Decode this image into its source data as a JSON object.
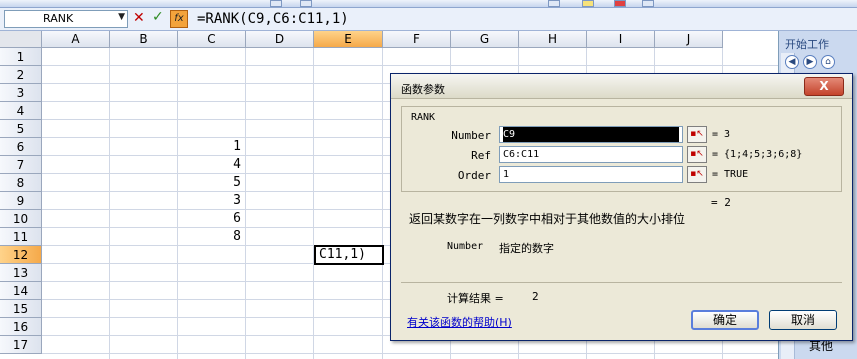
{
  "namebox": {
    "value": "RANK"
  },
  "formula_bar": {
    "formula": "=RANK(C9,C6:C11,1)",
    "fx_label": "fx"
  },
  "columns": [
    "A",
    "B",
    "C",
    "D",
    "E",
    "F",
    "G",
    "H",
    "I",
    "J"
  ],
  "active_column": "E",
  "rows": [
    "1",
    "2",
    "3",
    "4",
    "5",
    "6",
    "7",
    "8",
    "9",
    "10",
    "11",
    "12",
    "13",
    "14",
    "15",
    "16",
    "17"
  ],
  "active_row": "12",
  "cells_column_c": [
    "1",
    "4",
    "5",
    "3",
    "6",
    "8"
  ],
  "active_cell_text": "C11,1)",
  "task_pane": {
    "title": "开始工作",
    "footer": "其他"
  },
  "dialog": {
    "title": "函数参数",
    "close_label": "X",
    "function_name": "RANK",
    "args": [
      {
        "label": "Number",
        "value": "C9",
        "result": "= 3"
      },
      {
        "label": "Ref",
        "value": "C6:C11",
        "result": "= {1;4;5;3;6;8}"
      },
      {
        "label": "Order",
        "value": "1",
        "result": "= TRUE"
      }
    ],
    "formula_result": "= 2",
    "description": "返回某数字在一列数字中相对于其他数值的大小排位",
    "arg_help_name": "Number",
    "arg_help_desc": "指定的数字",
    "calc_label": "计算结果 =",
    "calc_value": "2",
    "help_link": "有关该函数的帮助(H)",
    "ok_label": "确定",
    "cancel_label": "取消"
  }
}
